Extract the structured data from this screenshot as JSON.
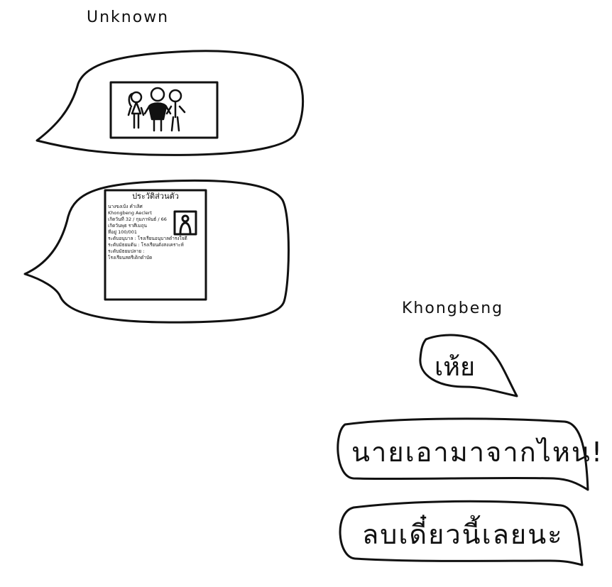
{
  "senders": {
    "unknown": "Unknown",
    "khongbeng": "Khongbeng"
  },
  "unknown_messages": {
    "photo_alt": "photo of three friends",
    "document": {
      "title": "ประวัติส่วนตัว",
      "lines": [
        "นางขงเบ้ง คำเลิศ",
        "Khongbeng Aeclert",
        "เกิดวันที่ 32 / กุมภาพันธ์ / 66",
        "เกิดวันพุธ ราศีเมถุน",
        "ที่อยู่ 100/001",
        "ระดับอนุบาล : โรงเรียนอนุบาลดำรงใจดี",
        "ระดับมัธยมต้น : โรงเรียนดังสงเคราะห์",
        "ระดับมัธยมปลาย :",
        "โรงเรียนสตรีเด็กดำบัด"
      ]
    }
  },
  "khongbeng_messages": [
    "เห้ย",
    "นายเอามาจากไหน!",
    "ลบเดี๋ยวนี้เลยนะ"
  ]
}
